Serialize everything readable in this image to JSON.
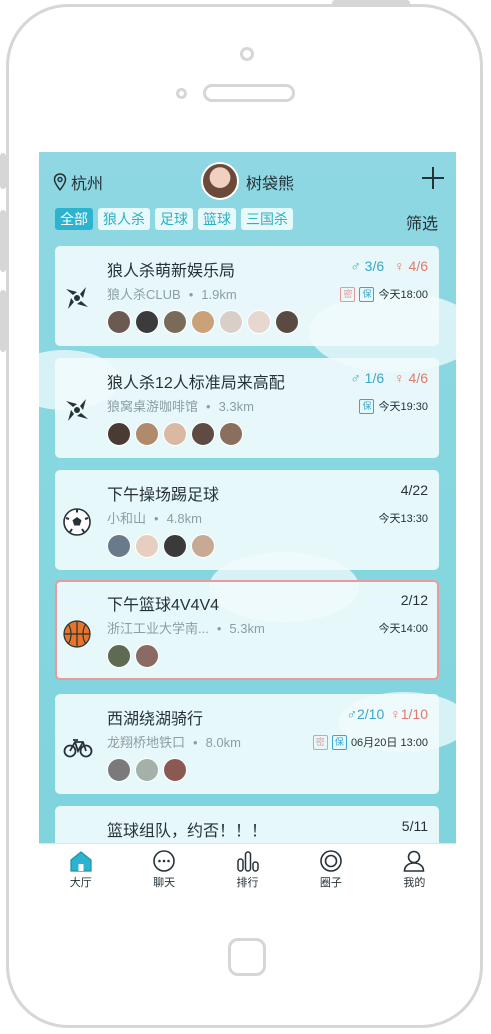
{
  "header": {
    "city": "杭州",
    "user_name": "树袋熊"
  },
  "filters": {
    "chips": [
      "全部",
      "狼人杀",
      "足球",
      "篮球",
      "三国杀"
    ],
    "filter_label": "筛选"
  },
  "colors": {
    "accent": "#2bb3cf",
    "male": "#3aa6c9",
    "female": "#e07a6c",
    "background": "#86d7e0",
    "selected_border": "#ea9a9a"
  },
  "events": [
    {
      "title": "狼人杀萌新娱乐局",
      "venue": "狼人杀CLUB",
      "sep": "•",
      "distance": "1.9km",
      "male": "♂ 3/6",
      "female": "♀ 4/6",
      "badges": [
        "密",
        "保"
      ],
      "time": "今天18:00",
      "icon": "werewolf-icon"
    },
    {
      "title": "狼人杀12人标准局来高配",
      "venue": "狼窝桌游咖啡馆",
      "sep": "•",
      "distance": "3.3km",
      "male": "♂ 1/6",
      "female": "♀ 4/6",
      "badges": [
        "保"
      ],
      "time": "今天19:30",
      "icon": "werewolf-icon"
    },
    {
      "title": "下午操场踢足球",
      "venue": "小和山",
      "sep": "•",
      "distance": "4.8km",
      "count": "4/22",
      "time": "今天13:30",
      "icon": "soccer-ball-icon"
    },
    {
      "title": "下午篮球4V4V4",
      "venue": "浙江工业大学南...",
      "sep": "•",
      "distance": "5.3km",
      "count": "2/12",
      "time": "今天14:00",
      "icon": "basketball-icon"
    },
    {
      "title": "西湖绕湖骑行",
      "venue": "龙翔桥地铁口",
      "sep": "•",
      "distance": "8.0km",
      "male": "♂2/10",
      "female": "♀1/10",
      "badges": [
        "密",
        "保"
      ],
      "time": "06月20日 13:00",
      "icon": "bicycle-icon"
    },
    {
      "title": "篮球组队，约否！！！",
      "count": "5/11"
    }
  ],
  "tabbar": {
    "items": [
      "大厅",
      "聊天",
      "排行",
      "圈子",
      "我的"
    ]
  }
}
